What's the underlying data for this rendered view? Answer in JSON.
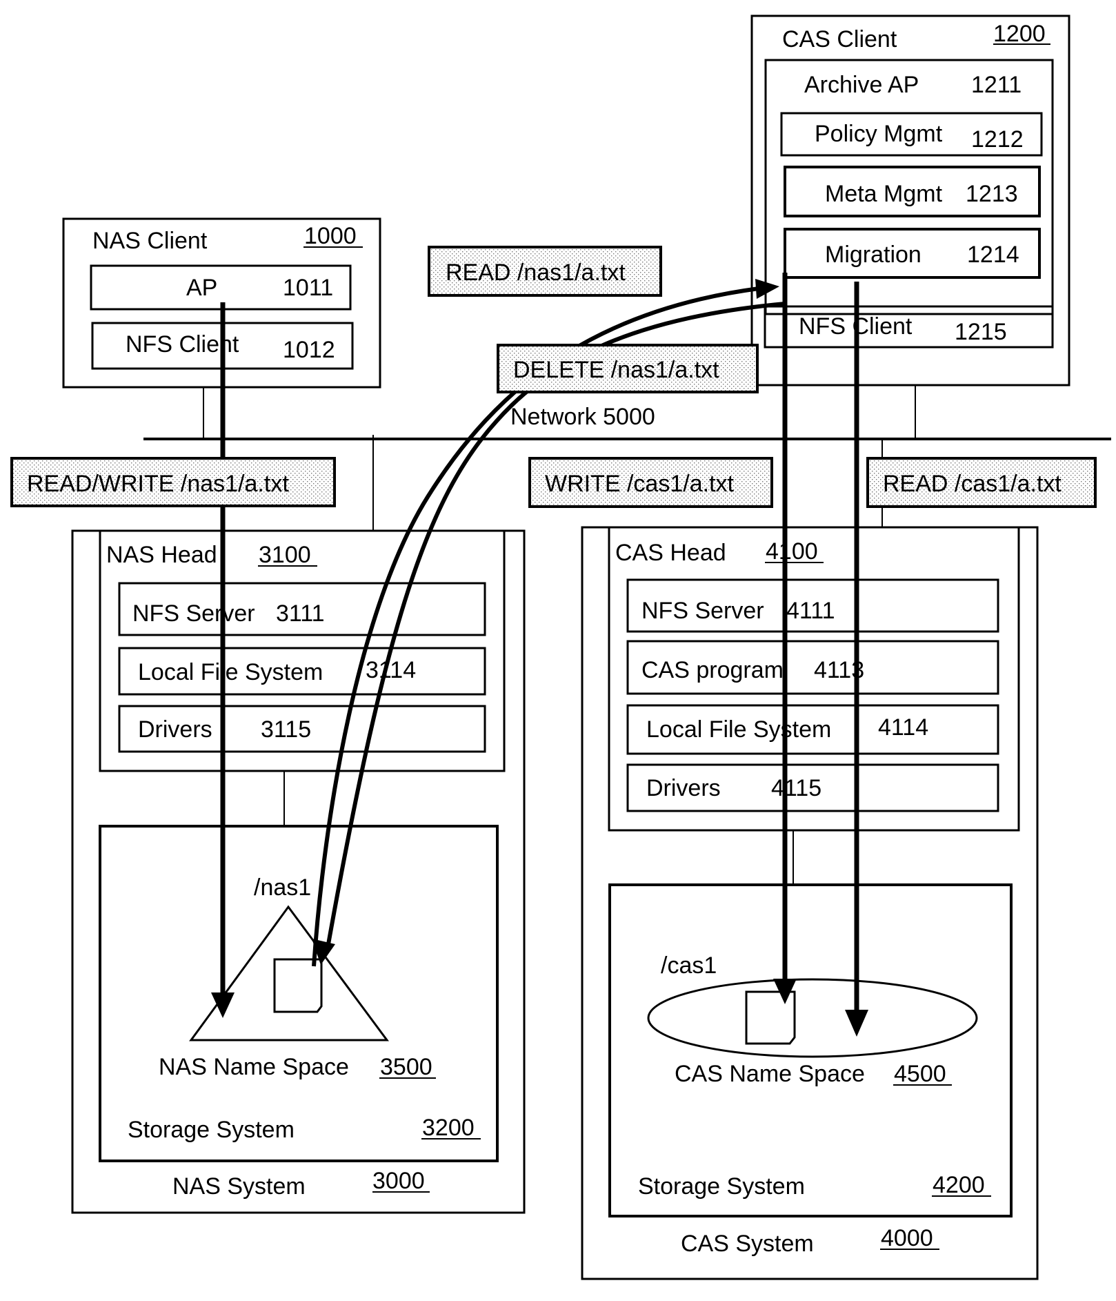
{
  "nas_client": {
    "title": "NAS Client",
    "ref": "1000",
    "ap": {
      "label": "AP",
      "ref": "1011"
    },
    "nfs_client": {
      "label": "NFS Client",
      "ref": "1012"
    }
  },
  "cas_client": {
    "title": "CAS Client",
    "ref": "1200",
    "archive_ap": {
      "label": "Archive AP",
      "ref": "1211"
    },
    "policy_mgmt": {
      "label": "Policy Mgmt",
      "ref": "1212"
    },
    "meta_mgmt": {
      "label": "Meta Mgmt",
      "ref": "1213"
    },
    "migration": {
      "label": "Migration",
      "ref": "1214"
    },
    "nfs_client": {
      "label": "NFS Client",
      "ref": "1215"
    }
  },
  "network": {
    "label": "Network 5000"
  },
  "operations": {
    "read_nas": "READ /nas1/a.txt",
    "delete_nas": "DELETE /nas1/a.txt",
    "readwrite_nas": "READ/WRITE /nas1/a.txt",
    "write_cas": "WRITE /cas1/a.txt",
    "read_cas": "READ /cas1/a.txt"
  },
  "nas_system": {
    "title": "NAS System",
    "ref": "3000",
    "head": {
      "title": "NAS Head",
      "ref": "3100",
      "nfs_server": {
        "label": "NFS Server",
        "ref": "3111"
      },
      "local_fs": {
        "label": "Local File System",
        "ref": "3114"
      },
      "drivers": {
        "label": "Drivers",
        "ref": "3115"
      }
    },
    "storage": {
      "title": "Storage System",
      "ref": "3200",
      "namespace_root": "/nas1",
      "namespace": {
        "label": "NAS Name Space",
        "ref": "3500"
      }
    }
  },
  "cas_system": {
    "title": "CAS System",
    "ref": "4000",
    "head": {
      "title": "CAS Head",
      "ref": "4100",
      "nfs_server": {
        "label": "NFS Server",
        "ref": "4111"
      },
      "cas_program": {
        "label": "CAS program",
        "ref": "4113"
      },
      "local_fs": {
        "label": "Local File System",
        "ref": "4114"
      },
      "drivers": {
        "label": "Drivers",
        "ref": "4115"
      }
    },
    "storage": {
      "title": "Storage System",
      "ref": "4200",
      "namespace_root": "/cas1",
      "namespace": {
        "label": "CAS Name Space",
        "ref": "4500"
      }
    }
  }
}
